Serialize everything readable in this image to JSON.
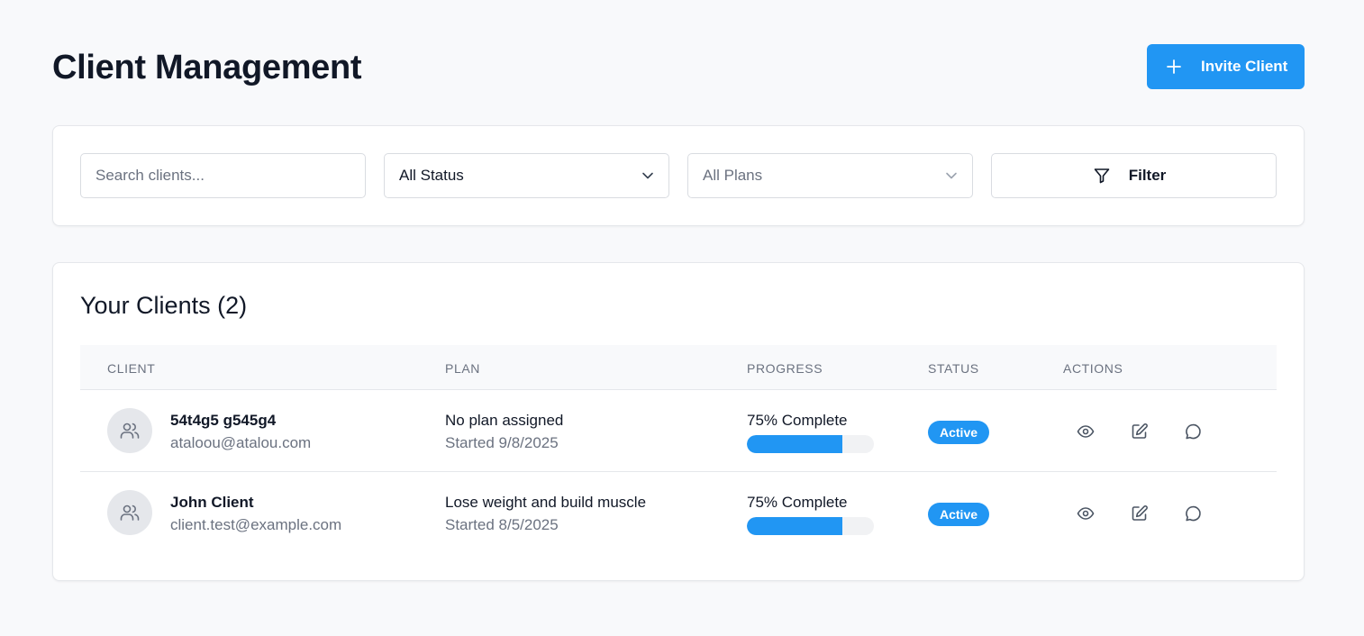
{
  "header": {
    "title": "Client Management",
    "invite_label": "Invite Client"
  },
  "filters": {
    "search_placeholder": "Search clients...",
    "status_value": "All Status",
    "plans_value": "All Plans",
    "filter_label": "Filter"
  },
  "clients_section": {
    "title": "Your Clients (2)",
    "columns": [
      "CLIENT",
      "PLAN",
      "PROGRESS",
      "STATUS",
      "ACTIONS"
    ],
    "rows": [
      {
        "name": "54t4g5 g545g4",
        "email": "ataloou@atalou.com",
        "plan": "No plan assigned",
        "started": "Started 9/8/2025",
        "progress_label": "75% Complete",
        "progress": 75,
        "status": "Active"
      },
      {
        "name": "John Client",
        "email": "client.test@example.com",
        "plan": "Lose weight and build muscle",
        "started": "Started 8/5/2025",
        "progress_label": "75% Complete",
        "progress": 75,
        "status": "Active"
      }
    ]
  },
  "icons": {
    "invite": "plus-icon",
    "status_dropdown": "chevron-down-icon",
    "plans_dropdown": "chevron-down-icon",
    "filter": "funnel-icon",
    "avatar": "users-icon",
    "view": "eye-icon",
    "edit": "edit-icon",
    "message": "message-circle-icon"
  },
  "colors": {
    "accent": "#2196f3",
    "background": "#f8f9fb",
    "muted_text": "#6b7280"
  }
}
